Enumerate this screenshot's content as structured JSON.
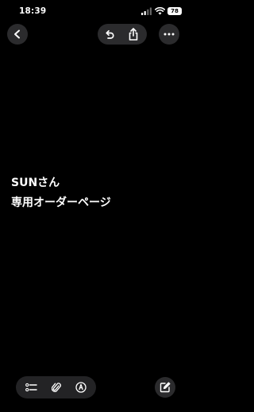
{
  "status_bar": {
    "time": "18:39",
    "battery": "78"
  },
  "toolbar": {
    "back_icon": "chevron-left-icon",
    "undo_icon": "undo-icon",
    "share_icon": "share-icon",
    "more_icon": "more-icon"
  },
  "note": {
    "lines": [
      "SUNさん",
      "専用オーダーページ"
    ]
  },
  "bottom_bar": {
    "checklist_icon": "checklist-icon",
    "attachment_icon": "paperclip-icon",
    "markup_icon": "markup-pen-icon",
    "compose_icon": "compose-icon"
  }
}
